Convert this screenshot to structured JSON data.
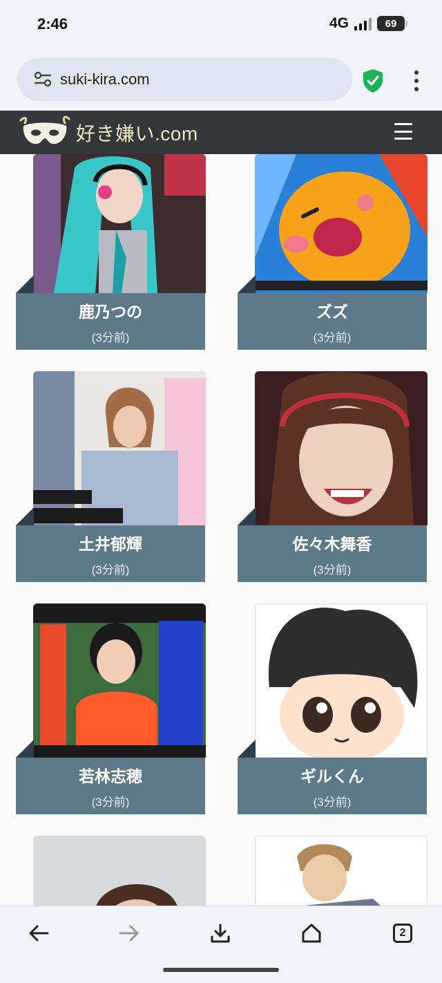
{
  "status_bar": {
    "time": "2:46",
    "network": "4G",
    "battery": "69"
  },
  "browser": {
    "url": "suki-kira.com",
    "tab_count": "2"
  },
  "site": {
    "title": "好き嫌い.com"
  },
  "cards": [
    {
      "name": "鹿乃つの",
      "time": "(3分前)"
    },
    {
      "name": "ズズ",
      "time": "(3分前)"
    },
    {
      "name": "土井郁輝",
      "time": "(3分前)"
    },
    {
      "name": "佐々木舞香",
      "time": "(3分前)"
    },
    {
      "name": "若林志穂",
      "time": "(3分前)"
    },
    {
      "name": "ギルくん",
      "time": "(3分前)"
    },
    {
      "name": "",
      "time": ""
    },
    {
      "name": "",
      "time": ""
    }
  ],
  "icons": {
    "back": "arrow-left-icon",
    "forward": "arrow-right-icon",
    "download": "download-icon",
    "home": "home-icon",
    "tabs": "tab-switcher-icon",
    "site_settings": "tune-icon",
    "security": "shield-check-icon",
    "menu": "more-vert-icon"
  },
  "colors": {
    "header_bg": "#333739",
    "label_bg": "#5e7a88",
    "shield": "#1db35a",
    "title_text": "#f3e6c4"
  }
}
